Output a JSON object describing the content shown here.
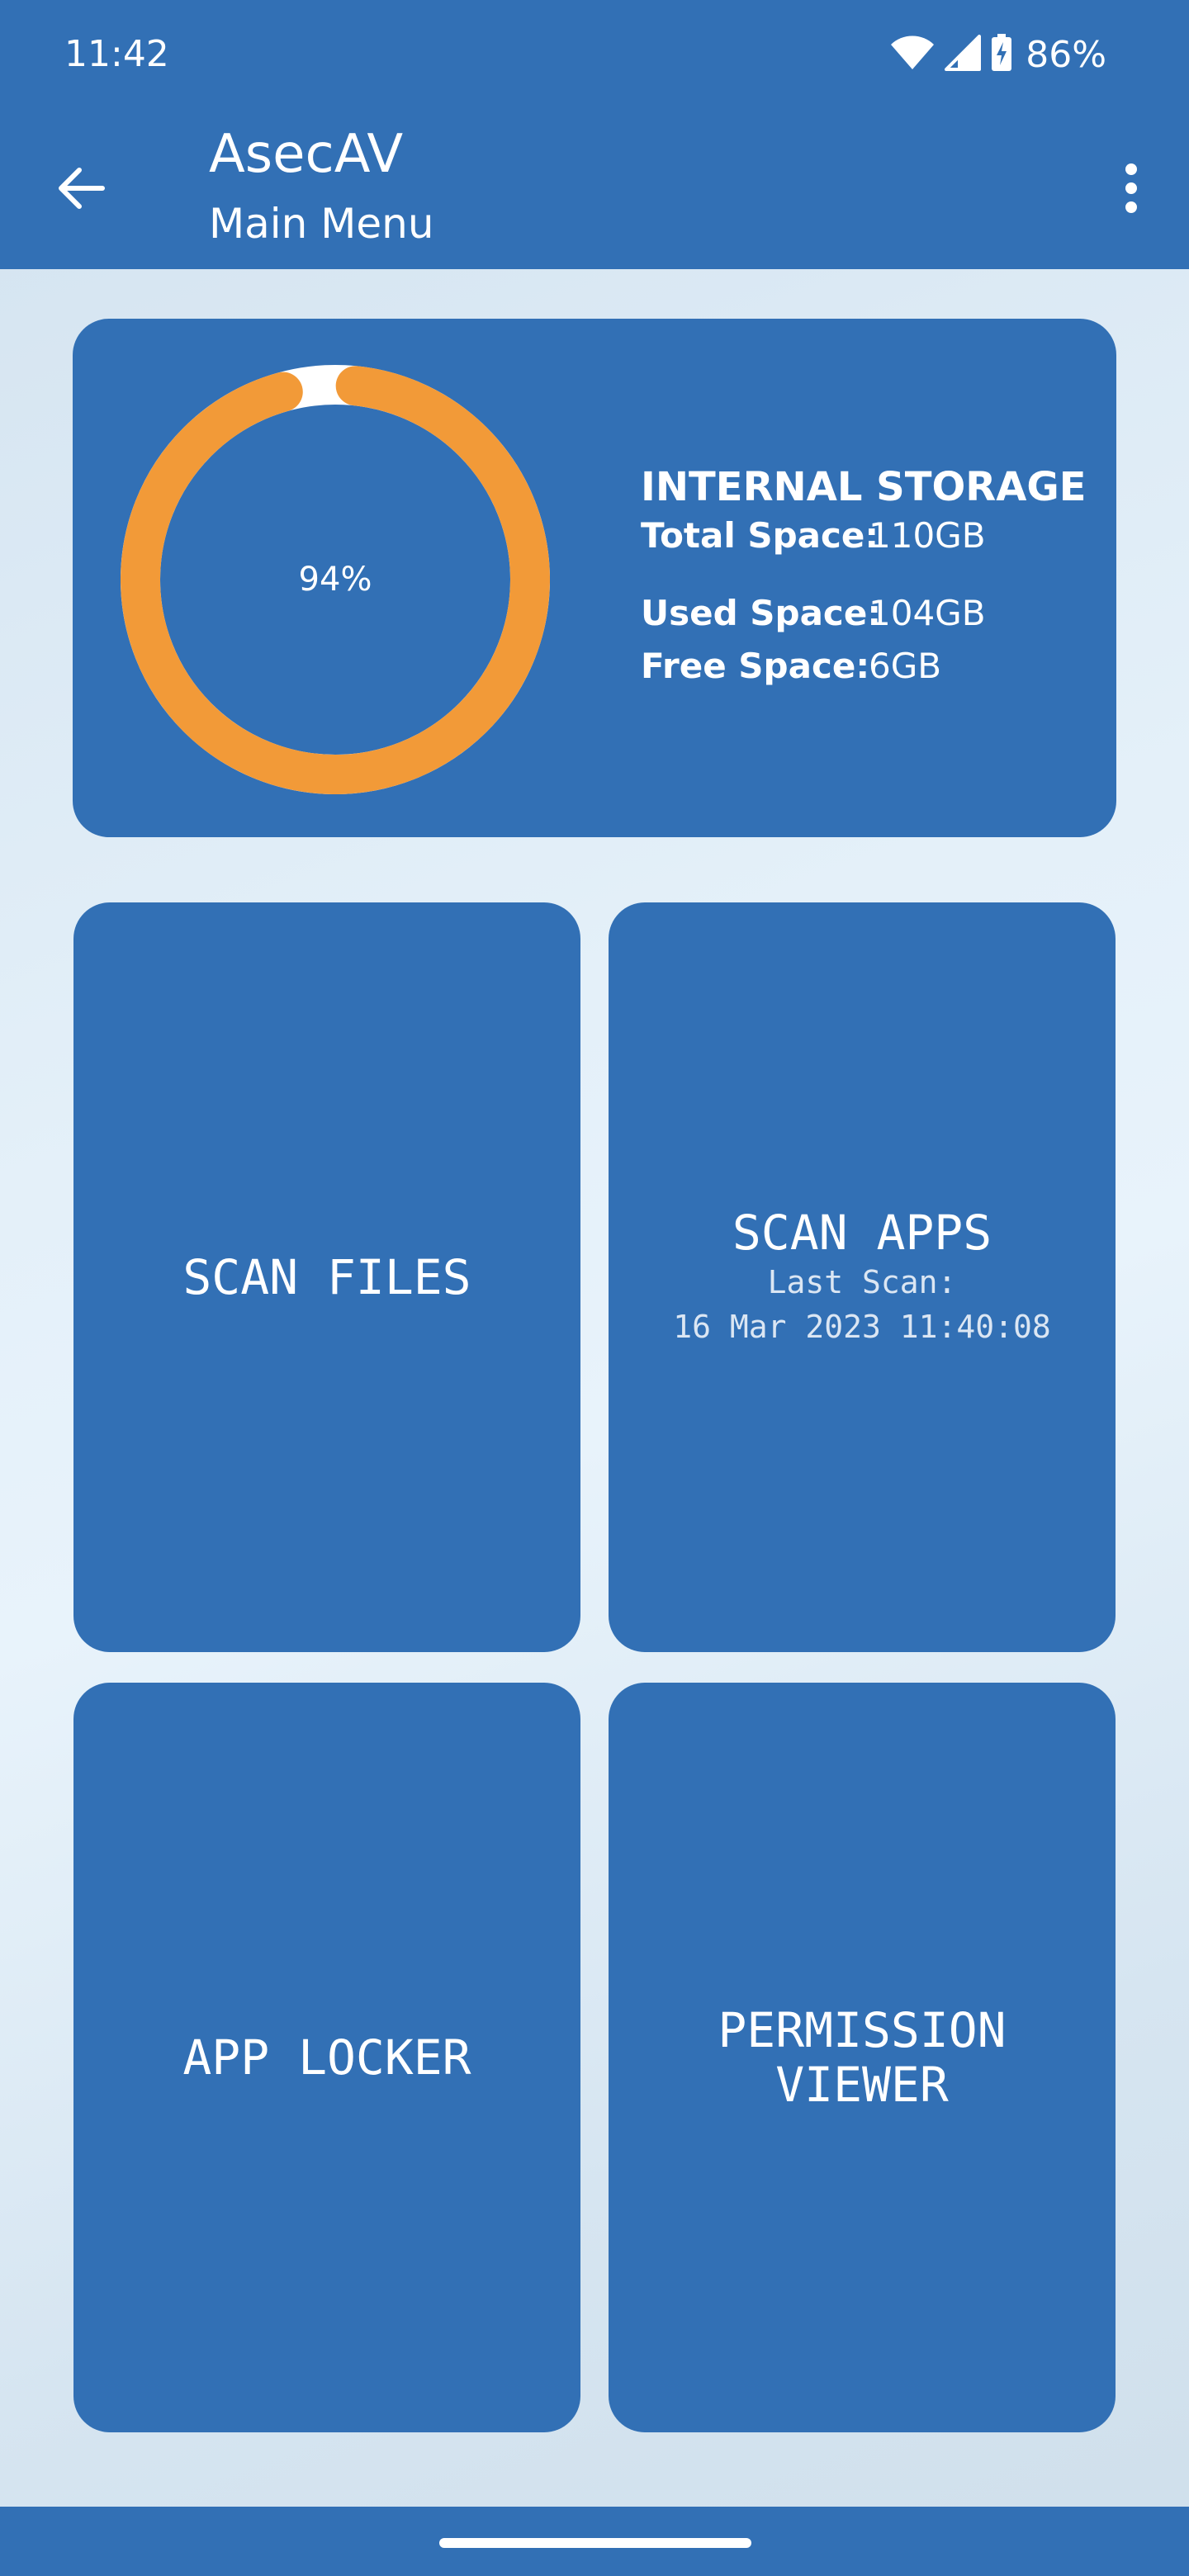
{
  "status_bar": {
    "time": "11:42",
    "battery": "86%"
  },
  "app_bar": {
    "title": "AsecAV",
    "subtitle": "Main Menu"
  },
  "storage": {
    "percent": 94,
    "percent_label": "94%",
    "heading": "INTERNAL STORAGE",
    "total_label": "Total Space:",
    "total_value": "110GB",
    "used_label": "Used Space:",
    "used_value": "104GB",
    "free_label": "Free Space:",
    "free_value": "6GB",
    "ring_color": "#f29a38",
    "track_color": "#ffffff"
  },
  "tiles": {
    "scan_files": {
      "title": "SCAN FILES"
    },
    "scan_apps": {
      "title": "SCAN APPS",
      "last_scan_label": "Last Scan:",
      "last_scan_value": "16 Mar 2023 11:40:08"
    },
    "app_locker": {
      "title": "APP LOCKER"
    },
    "permission_viewer": {
      "title_line1": "PERMISSION",
      "title_line2": "VIEWER"
    }
  },
  "colors": {
    "primary": "#3270b5",
    "accent": "#f29a38"
  },
  "icons": {
    "back": "arrow-left-icon",
    "overflow": "more-vertical-icon",
    "wifi": "wifi-icon",
    "signal": "signal-icon",
    "battery": "battery-charging-icon"
  }
}
